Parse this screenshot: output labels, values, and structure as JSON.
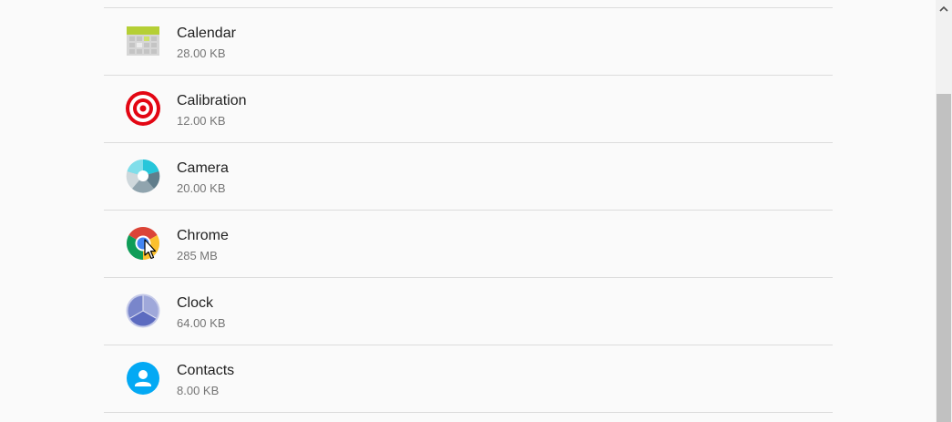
{
  "apps": [
    {
      "name": "Calendar",
      "size": "28.00 KB",
      "icon": "calendar-icon"
    },
    {
      "name": "Calibration",
      "size": "12.00 KB",
      "icon": "calibration-icon"
    },
    {
      "name": "Camera",
      "size": "20.00 KB",
      "icon": "camera-icon"
    },
    {
      "name": "Chrome",
      "size": "285 MB",
      "icon": "chrome-icon"
    },
    {
      "name": "Clock",
      "size": "64.00 KB",
      "icon": "clock-icon"
    },
    {
      "name": "Contacts",
      "size": "8.00 KB",
      "icon": "contacts-icon"
    }
  ],
  "colors": {
    "background": "#fafafa",
    "divider": "#dcdcdc",
    "primary_text": "#212121",
    "secondary_text": "#757575",
    "scrollbar_thumb": "#c1c1c1"
  }
}
